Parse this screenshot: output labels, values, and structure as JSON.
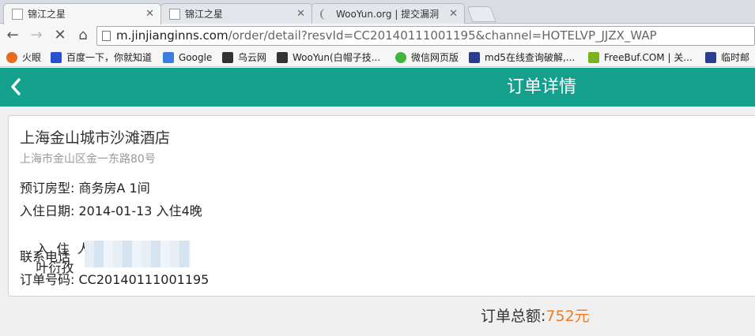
{
  "browser": {
    "tabs": [
      {
        "title": "锦江之星",
        "active": true
      },
      {
        "title": "锦江之星",
        "active": false
      },
      {
        "title": "WooYun.org | 提交漏洞",
        "active": false
      }
    ],
    "url_host": "m.jinjianginns.com",
    "url_path": "/order/detail?resvId=CC20140111001195&channel=HOTELVP_JJZX_WAP",
    "bookmarks": [
      {
        "label": "火眼",
        "icon": "huoyan-icon",
        "color": "#e86a1c"
      },
      {
        "label": "百度一下，你就知道",
        "icon": "baidu-icon",
        "color": "#2a4fd0"
      },
      {
        "label": "Google",
        "icon": "google-icon",
        "color": "#3b7de0"
      },
      {
        "label": "乌云网",
        "icon": "wooyun-icon",
        "color": "#333333"
      },
      {
        "label": "WooYun(白帽子技...",
        "icon": "wooyun-icon",
        "color": "#333333"
      },
      {
        "label": "微信网页版",
        "icon": "wechat-icon",
        "color": "#3fb53b"
      },
      {
        "label": "md5在线查询破解,...",
        "icon": "md5-icon",
        "color": "#2a3d8f"
      },
      {
        "label": "FreeBuf.COM | 关...",
        "icon": "freebuf-icon",
        "color": "#7cb21b"
      },
      {
        "label": "临时邮",
        "icon": "tempmail-icon",
        "color": "#2a3d8f"
      }
    ]
  },
  "header": {
    "back_icon": "chevron-left-icon",
    "title": "订单详情"
  },
  "order": {
    "hotel_name": "上海金山城市沙滩酒店",
    "hotel_address": "上海市金山区金一东路80号",
    "room_type_label": "预订房型:",
    "room_type_value": "商务房A 1间",
    "checkin_label": "入住日期:",
    "checkin_value": "2014-01-13 入住4晚",
    "guest_label": "入  住  人:",
    "guest_value": "叶衍孜",
    "phone_label": "联系电话",
    "order_no_label": "订单号码:",
    "order_no_value": "CC20140111001195"
  },
  "total": {
    "label": "订单总额:",
    "amount": "752元"
  },
  "colors": {
    "accent": "#13a08c",
    "amount": "#f07a22"
  }
}
